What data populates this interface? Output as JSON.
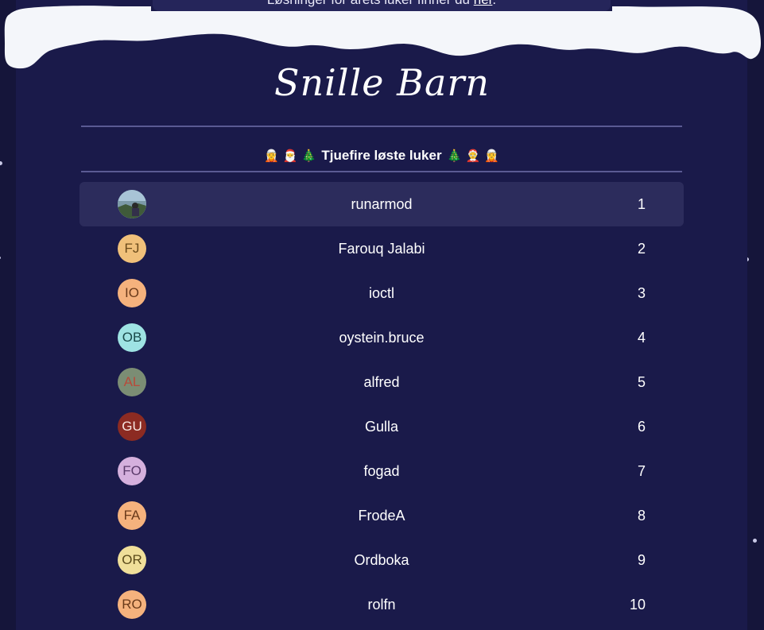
{
  "banner": {
    "text": "Løsninger for årets luker finner du ",
    "link_label": "her",
    "suffix": "."
  },
  "site_title": "Snille Barn",
  "subtitle": {
    "text": "Tjuefire løste luker",
    "left_emoji": "🧝 🎅 🎄",
    "right_emoji": "🎄 🤶 🧝"
  },
  "leaderboard": [
    {
      "name": "runarmod",
      "rank": "1",
      "initials": "",
      "avatar_type": "photo",
      "bg": "#6c8fa0",
      "fg": "#ffffff",
      "highlighted": true
    },
    {
      "name": "Farouq Jalabi",
      "rank": "2",
      "initials": "FJ",
      "avatar_type": "initials",
      "bg": "#f0c07a",
      "fg": "#6a4a1a",
      "highlighted": false
    },
    {
      "name": "ioctl",
      "rank": "3",
      "initials": "IO",
      "avatar_type": "initials",
      "bg": "#f5b27d",
      "fg": "#6a3a1a",
      "highlighted": false
    },
    {
      "name": "oystein.bruce",
      "rank": "4",
      "initials": "OB",
      "avatar_type": "initials",
      "bg": "#9ee3e3",
      "fg": "#1a4a4a",
      "highlighted": false
    },
    {
      "name": "alfred",
      "rank": "5",
      "initials": "AL",
      "avatar_type": "initials",
      "bg": "#7b8d74",
      "fg": "#b84a3a",
      "highlighted": false
    },
    {
      "name": "Gulla",
      "rank": "6",
      "initials": "GU",
      "avatar_type": "initials",
      "bg": "#8c2b22",
      "fg": "#f7e6e0",
      "highlighted": false
    },
    {
      "name": "fogad",
      "rank": "7",
      "initials": "FO",
      "avatar_type": "initials",
      "bg": "#d5b0dd",
      "fg": "#5a3a6a",
      "highlighted": false
    },
    {
      "name": "FrodeA",
      "rank": "8",
      "initials": "FA",
      "avatar_type": "initials",
      "bg": "#f5b27d",
      "fg": "#6a3a1a",
      "highlighted": false
    },
    {
      "name": "Ordboka",
      "rank": "9",
      "initials": "OR",
      "avatar_type": "initials",
      "bg": "#f0df9a",
      "fg": "#5a4a1a",
      "highlighted": false
    },
    {
      "name": "rolfn",
      "rank": "10",
      "initials": "RO",
      "avatar_type": "initials",
      "bg": "#f5b27d",
      "fg": "#6a3a1a",
      "highlighted": false
    }
  ],
  "colors": {
    "background": "#15153a",
    "panel": "#1a1a4a",
    "row_highlight": "#2c2c5c",
    "snow": "#f4f6fa",
    "divider": "#5a5a93"
  }
}
